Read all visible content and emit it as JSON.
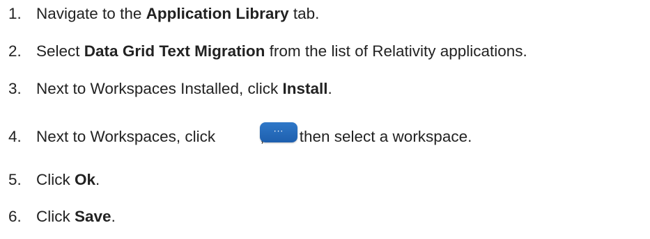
{
  "steps": [
    {
      "number": "1.",
      "before": "Navigate to the ",
      "bold": "Application Library",
      "after": " tab."
    },
    {
      "number": "2.",
      "before": "Select ",
      "bold": "Data Grid Text Migration",
      "after": " from the list of Relativity applications."
    },
    {
      "number": "3.",
      "before": "Next to Workspaces Installed, click ",
      "bold": "Install",
      "after": "."
    },
    {
      "number": "4.",
      "before": "Next to Workspaces, click ",
      "after": ", and then select a workspace.",
      "button_icon": "ellipsis-icon",
      "button_glyph": "···"
    },
    {
      "number": "5.",
      "before": "Click ",
      "bold": "Ok",
      "after": "."
    },
    {
      "number": "6.",
      "before": "Click ",
      "bold": "Save",
      "after": "."
    }
  ],
  "colors": {
    "text": "#222222",
    "button": "#2a6fbe"
  }
}
